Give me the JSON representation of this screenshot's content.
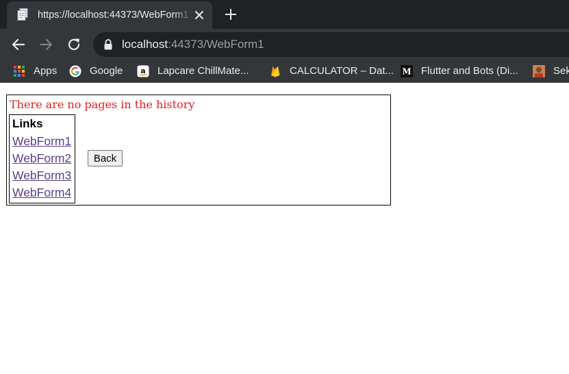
{
  "browser": {
    "tab": {
      "title": "https://localhost:44373/WebForm1"
    },
    "address_bar": {
      "host": "localhost",
      "rest": ":44373/WebForm1"
    },
    "bookmarks": [
      {
        "label": "Apps",
        "icon": "apps-grid-icon"
      },
      {
        "label": "Google",
        "icon": "google-icon"
      },
      {
        "label": "Lapcare ChillMate...",
        "icon": "amazon-icon"
      },
      {
        "label": "CALCULATOR – Dat...",
        "icon": "firebase-icon"
      },
      {
        "label": "Flutter and Bots (Di...",
        "icon": "medium-icon"
      },
      {
        "label": "Sek",
        "icon": "avatar-icon"
      }
    ]
  },
  "page": {
    "message": "There are no pages in the history",
    "links_header": "Links",
    "links": [
      "WebForm1",
      "WebForm2",
      "WebForm3",
      "WebForm4"
    ],
    "back_button": "Back"
  },
  "colors": {
    "message": "#e0211d",
    "link": "#5a3d8a",
    "chrome_dark": "#202124",
    "chrome_toolbar": "#35363a"
  }
}
